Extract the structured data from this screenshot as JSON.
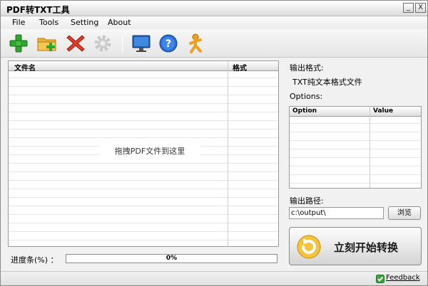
{
  "window": {
    "title": "PDF转TXT工具",
    "minimize_glyph": "_",
    "close_glyph": "X"
  },
  "menu": {
    "items": [
      "File",
      "Tools",
      "Setting",
      "About"
    ]
  },
  "toolbar": {
    "icons": [
      "add-icon",
      "add-folder-icon",
      "delete-icon",
      "settings-icon",
      "monitor-icon",
      "help-icon",
      "run-icon"
    ],
    "settings_disabled": true
  },
  "file_list": {
    "columns": [
      "文件名",
      "格式"
    ],
    "drop_hint": "拖拽PDF文件到这里"
  },
  "progress": {
    "label": "进度条(%) ：",
    "value_text": "0%",
    "value": 0
  },
  "output": {
    "format_label": "输出格式:",
    "format_value": "TXT纯文本格式文件",
    "options_label": "Options:",
    "options_columns": [
      "Option",
      "Value"
    ],
    "path_label": "输出路径:",
    "path_value": "c:\\output\\",
    "browse_label": "浏览",
    "convert_label": "立刻开始转换"
  },
  "statusbar": {
    "feedback_label": "Feedback"
  },
  "colors": {
    "progress_fill": "#4caf50",
    "accent_orange": "#f0a020"
  }
}
